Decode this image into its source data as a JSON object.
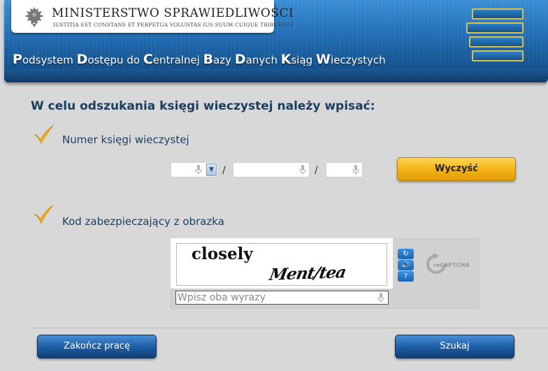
{
  "header": {
    "ministry_name": "MINISTERSTWO SPRAWIEDLIWOŚCI",
    "motto": "IUSTITIA EST CONSTANS ET PERPETUA VOLUNTAS IUS SUUM CUIQUE TRIBUENDI",
    "system_title": "Podsystem Dostępu do Centralnej Bazy Danych Ksiąg Wieczystych"
  },
  "form": {
    "heading": "W celu odszukania księgi wieczystej należy wpisać:",
    "kw_section": {
      "label": "Numer księgi wieczystej",
      "court_code_value": "",
      "number_value": "",
      "check_digit_value": "",
      "separator": "/"
    },
    "clear_button": "Wyczyść",
    "captcha_section": {
      "label": "Kod zabezpieczający z obrazka",
      "word1": "closely",
      "word2": "Ment/tea",
      "input_placeholder": "Wpisz oba wyrazy",
      "input_value": "",
      "brand": "reCAPTCHA"
    }
  },
  "footer": {
    "end_button": "Zakończ pracę",
    "search_button": "Szukaj"
  },
  "colors": {
    "header_blue": "#1d62a8",
    "accent_orange": "#f5b418",
    "text_navy": "#1b3e5e"
  }
}
